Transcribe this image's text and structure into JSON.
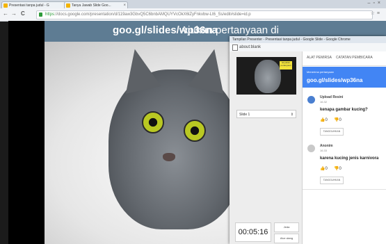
{
  "browser": {
    "tabs": [
      {
        "label": "Presentasi tanpa judul - G"
      },
      {
        "label": "Tanya Jawab Slide Goo..."
      }
    ],
    "url_scheme": "https",
    "url_rest": "://docs.google.com/presentation/d/119aw3GbvQ5C6bnbAMQUYVcOkX6lZyFnkvbw-Lt6_Ss/edit#slide=id.p",
    "nav_back": "←",
    "nav_forward": "→",
    "nav_reload": "C"
  },
  "slide": {
    "banner_prefix": "Ajukan pertanyaan di ",
    "banner_link": "goo.gl/slides/wp36na"
  },
  "presenter_window": {
    "title": "Tampilan Presenter - Presentasi tanpa judul - Google Slide - Google Chrome",
    "address": "about:blank",
    "thumbnail_sticky_text": "tanyakan pertanyaan",
    "slide_selector": "Slide 1",
    "timer": "00:05:16",
    "pause_label": "Jeda",
    "reset_label": "Atur ulang",
    "tabs": [
      "ALAT PEMIRSA",
      "CATATAN PEMBICARA"
    ],
    "qa_header_small": "Menerima pertanyaan",
    "qa_header_link": "goo.gl/slides/wp36na",
    "questions": [
      {
        "author": "Upload Resini",
        "time": "16.32",
        "text": "kenapa gambar kucing?",
        "upvotes": "0",
        "downvotes": "0",
        "hide_label": "TANGGUHKAN",
        "avatar_color": "#4a7fd0"
      },
      {
        "author": "Anonim",
        "time": "16.33",
        "text": "karena kucing jenis karnivora",
        "upvotes": "0",
        "downvotes": "0",
        "hide_label": "TANGGUHKAN",
        "avatar_color": "#c9c9c9"
      }
    ]
  }
}
